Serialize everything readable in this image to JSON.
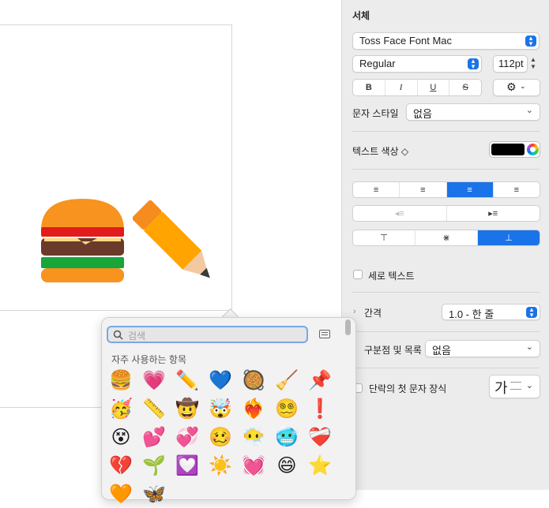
{
  "inspector": {
    "font_section_title": "서체",
    "font_family": "Toss Face Font Mac",
    "font_style": "Regular",
    "font_size": "112pt",
    "bold_label": "B",
    "italic_label": "I",
    "underline_label": "U",
    "strike_label": "S",
    "char_style_label": "문자 스타일",
    "char_style_value": "없음",
    "text_color_label": "텍스트 색상 ◇",
    "vertical_text_label": "세로 텍스트",
    "spacing_label": "간격",
    "spacing_value": "1.0 - 한 줄",
    "bullets_label": "구분점 및 목록",
    "bullets_value": "없음",
    "dropcap_label": "단락의 첫 문자 장식",
    "dropcap_glyph": "가"
  },
  "canvas": {
    "emojis": [
      "🍔",
      "✏️"
    ]
  },
  "emoji_picker": {
    "search_placeholder": "검색",
    "section_title": "자주 사용하는 항목",
    "emojis": [
      "🍔",
      "💗",
      "✏️",
      "💙",
      "🥘",
      "🧹",
      "📌",
      "🥳",
      "📏",
      "🤠",
      "🤯",
      "❤️‍🔥",
      "😵‍💫",
      "❗",
      "😵",
      "💕",
      "💞",
      "🥴",
      "😶‍🌫️",
      "🥶",
      "❤️‍🩹",
      "💔",
      "🌱",
      "💟",
      "☀️",
      "💓",
      "😄",
      "⭐",
      "🧡",
      "🦋"
    ]
  },
  "colors": {
    "accent": "#1a73e8",
    "text_color_swatch": "#000000"
  }
}
